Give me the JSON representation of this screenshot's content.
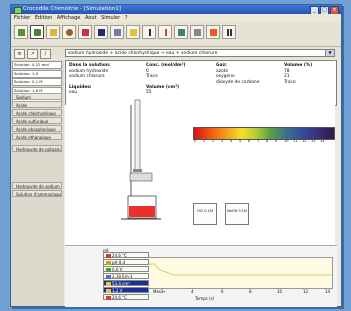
{
  "window": {
    "title": "Crocodile Chimistrie - [Simulation1]"
  },
  "menu": [
    "Fichier",
    "Edition",
    "Affichage",
    "Aout",
    "Simuler",
    "?"
  ],
  "toolbar": {
    "icons": [
      "lab-icon",
      "flask-icon",
      "beaker-icon",
      "gear-icon",
      "test-tube-icon",
      "periodic-table-icon",
      "arrow-icon",
      "text-icon",
      "mirror-icon",
      "thermometer-icon",
      "notebook-icon",
      "pause-icon"
    ]
  },
  "reaction_select": "sodium hydroxide + acide chlorhydrique → eau + sodium chlorure",
  "readouts": [
    "Solution: 0,22 mol",
    "Solution: 1,9",
    "Solution: 0,1 M",
    "Solution: 1,6 M",
    "Solution: 0,1 M"
  ],
  "left_buttons": [
    "Sodium",
    "Acide",
    "Acide chlorhydrique",
    "Acide sulfurique",
    "Acide phosphorique",
    "Acide ethanoique",
    "Hydroxyde de potassium",
    "Hydroxyde de sodium",
    "Solution d'ammoniaque"
  ],
  "info": {
    "solution_header": "Dans la solution:",
    "conc_header": "Conc. (mol/dm³)",
    "gas_header": "Gaz:",
    "volume_header": "Volume (%)",
    "solutes": [
      {
        "name": "sodium hydroxide",
        "conc": "0"
      },
      {
        "name": "sodium chlorure",
        "conc": "Trace"
      }
    ],
    "gases": [
      {
        "name": "azote",
        "volume": "78"
      },
      {
        "name": "oxygene",
        "volume": "21"
      },
      {
        "name": "dioxyde de carbone",
        "volume": "Trace"
      }
    ],
    "liquid_header": "Liquides:",
    "liquid_volume_header": "Volume (cm³)",
    "liquids": [
      {
        "name": "eau",
        "volume": "55"
      }
    ]
  },
  "ph_scale": {
    "ticks": [
      "0",
      "1",
      "2",
      "3",
      "4",
      "5",
      "6",
      "7",
      "8",
      "9",
      "10",
      "11",
      "12",
      "13",
      "14"
    ]
  },
  "bottles": [
    {
      "label": "HCl 0.1M"
    },
    {
      "label": "NaOH 0.1M"
    }
  ],
  "chart": {
    "ylabel": "pH",
    "xlabel": "Temps (s)",
    "xticks": [
      "0",
      "2",
      "4",
      "6",
      "8",
      "10",
      "12",
      "14"
    ],
    "left_unit": "Mes →",
    "sensors": [
      {
        "label": "24,6 °C",
        "selected": false
      },
      {
        "label": "pH 8,4",
        "selected": false
      },
      {
        "label": "0,0 V",
        "selected": false
      },
      {
        "label": "2,18 Em-1",
        "selected": false
      },
      {
        "label": "53,4 cm³",
        "selected": true
      },
      {
        "label": "1,2 V",
        "selected": true
      },
      {
        "label": "24,6 °C",
        "selected": false
      }
    ]
  }
}
